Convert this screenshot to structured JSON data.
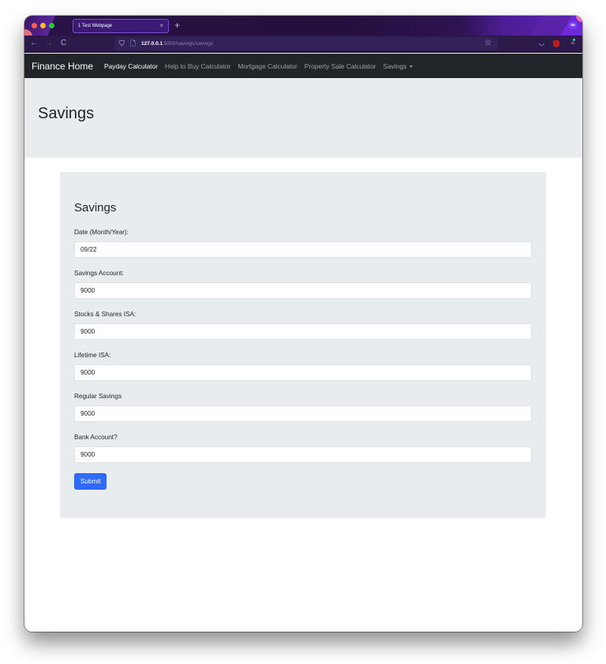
{
  "browser": {
    "tab": {
      "title": "1 Test Webpage",
      "close_glyph": "×"
    },
    "new_tab_glyph": "+",
    "nav": {
      "back_glyph": "←",
      "forward_glyph": "→",
      "reload_glyph": "C"
    },
    "url": {
      "host": "127.0.0.1",
      "rest": ":5000/savings/savings"
    },
    "icons": {
      "shield_glyph": "⛉",
      "page_glyph": "🗋",
      "star_glyph": "☆",
      "pocket_glyph": "◡",
      "menu_glyph": "≡",
      "avatar_glyph": "∞"
    }
  },
  "navbar": {
    "brand": "Finance Home",
    "links": [
      {
        "label": "Payday Calculator",
        "active": true
      },
      {
        "label": "Help to Buy Calculator",
        "active": false
      },
      {
        "label": "Mortgage Calculator",
        "active": false
      },
      {
        "label": "Property Sale Calculator",
        "active": false
      }
    ],
    "dropdown": {
      "label": "Savings"
    }
  },
  "header": {
    "title": "Savings"
  },
  "form": {
    "title": "Savings",
    "fields": [
      {
        "label": "Date (Month/Year):",
        "value": "09/22"
      },
      {
        "label": "Savings Account:",
        "value": "9000"
      },
      {
        "label": "Stocks & Shares ISA:",
        "value": "9000"
      },
      {
        "label": "Lifetime ISA:",
        "value": "9000"
      },
      {
        "label": "Regular Savings",
        "value": "9000"
      },
      {
        "label": "Bank Account?",
        "value": "9000"
      }
    ],
    "submit_label": "Submit"
  },
  "colors": {
    "primary": "#2f6bf7",
    "navbar_bg": "#212529",
    "jumbotron_bg": "#e9ecef"
  }
}
